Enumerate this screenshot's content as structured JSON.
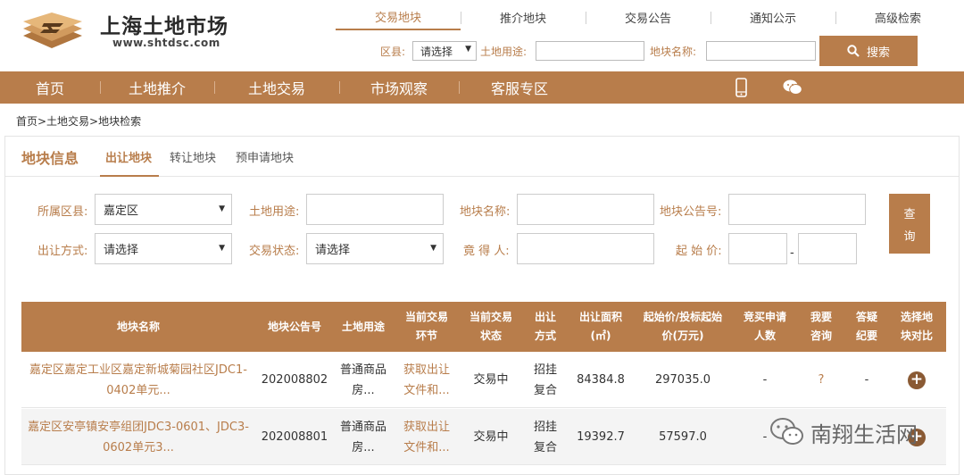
{
  "header": {
    "logo_title": "上海土地市场",
    "logo_url": "www.shtdsc.com",
    "tabs": [
      "交易地块",
      "推介地块",
      "交易公告",
      "通知公示",
      "高级检索"
    ],
    "search": {
      "district_label": "区县:",
      "district_value": "请选择",
      "use_label": "土地用途:",
      "name_label": "地块名称:",
      "button_label": "搜索"
    }
  },
  "nav": {
    "items": [
      "首页",
      "土地推介",
      "土地交易",
      "市场观察",
      "客服专区"
    ],
    "icons": [
      "mobile-phone-icon",
      "wechat-icon"
    ]
  },
  "breadcrumb": "首页>土地交易>地块检索",
  "panel": {
    "title": "地块信息",
    "tabs": [
      "出让地块",
      "转让地块",
      "预申请地块"
    ]
  },
  "filters": {
    "district_label": "所属区县:",
    "district_value": "嘉定区",
    "use_label": "土地用途:",
    "name_label": "地块名称:",
    "notice_label": "地块公告号:",
    "method_label": "出让方式:",
    "method_value": "请选择",
    "status_label": "交易状态:",
    "status_value": "请选择",
    "bidder_label": "竟 得 人:",
    "price_label": "起 始 价:",
    "price_sep": "-",
    "query_button": [
      "查",
      "询"
    ]
  },
  "table": {
    "headers": [
      [
        "地块名称"
      ],
      [
        "地块公告号"
      ],
      [
        "土地用途"
      ],
      [
        "当前交易",
        "环节"
      ],
      [
        "当前交易",
        "状态"
      ],
      [
        "出让",
        "方式"
      ],
      [
        "出让面积",
        "(㎡)"
      ],
      [
        "起始价/投标起始",
        "价(万元)"
      ],
      [
        "竞买申请",
        "人数"
      ],
      [
        "我要",
        "咨询"
      ],
      [
        "答疑",
        "纪要"
      ],
      [
        "选择地",
        "块对比"
      ]
    ],
    "rows": [
      {
        "name": [
          "嘉定区嘉定工业区嘉定新城菊园社区JDC1-",
          "0402单元..."
        ],
        "notice_no": "202008802",
        "use": [
          "普通商品",
          "房..."
        ],
        "stage": [
          "获取出让",
          "文件和..."
        ],
        "status": "交易中",
        "method": [
          "招挂",
          "复合"
        ],
        "area": "84384.8",
        "price": "297035.0",
        "applicants": "-",
        "consult": "?",
        "qa": "-",
        "compare": "+"
      },
      {
        "name": [
          "嘉定区安亭镇安亭组团JDC3-0601、JDC3-",
          "0602单元3..."
        ],
        "notice_no": "202008801",
        "use": [
          "普通商品",
          "房..."
        ],
        "stage": [
          "获取出让",
          "文件和..."
        ],
        "status": "交易中",
        "method": [
          "招挂",
          "复合"
        ],
        "area": "19392.7",
        "price": "57597.0",
        "applicants": "-",
        "consult": "",
        "qa": "",
        "compare": "+"
      }
    ]
  },
  "watermark": "南翔生活网",
  "colors": {
    "brand": "#b87d4b",
    "dark": "#8a5a34"
  }
}
